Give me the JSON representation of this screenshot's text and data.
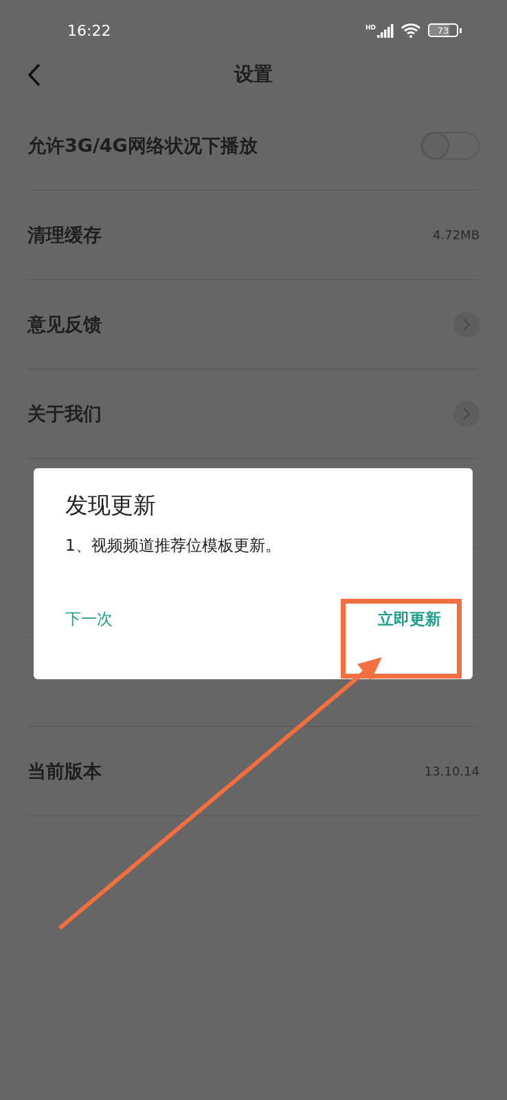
{
  "status_bar": {
    "time": "16:22",
    "network_label": "HD",
    "battery": "73"
  },
  "header": {
    "title": "设置"
  },
  "settings": [
    {
      "kind": "toggle",
      "label": "允许3G/4G网络状况下播放",
      "on": false
    },
    {
      "kind": "value",
      "label": "清理缓存",
      "value": "4.72MB"
    },
    {
      "kind": "link",
      "label": "意见反馈"
    },
    {
      "kind": "link",
      "label": "关于我们"
    },
    {
      "kind": "covered"
    },
    {
      "kind": "covered"
    },
    {
      "kind": "covered"
    },
    {
      "kind": "value",
      "label": "当前版本",
      "value": "13.10.14"
    }
  ],
  "dialog": {
    "title": "发现更新",
    "message": "1、视频频道推荐位模板更新。",
    "buttons": [
      {
        "label": "下一次",
        "highlighted": false
      },
      {
        "label": "立即更新",
        "highlighted": true
      }
    ]
  }
}
